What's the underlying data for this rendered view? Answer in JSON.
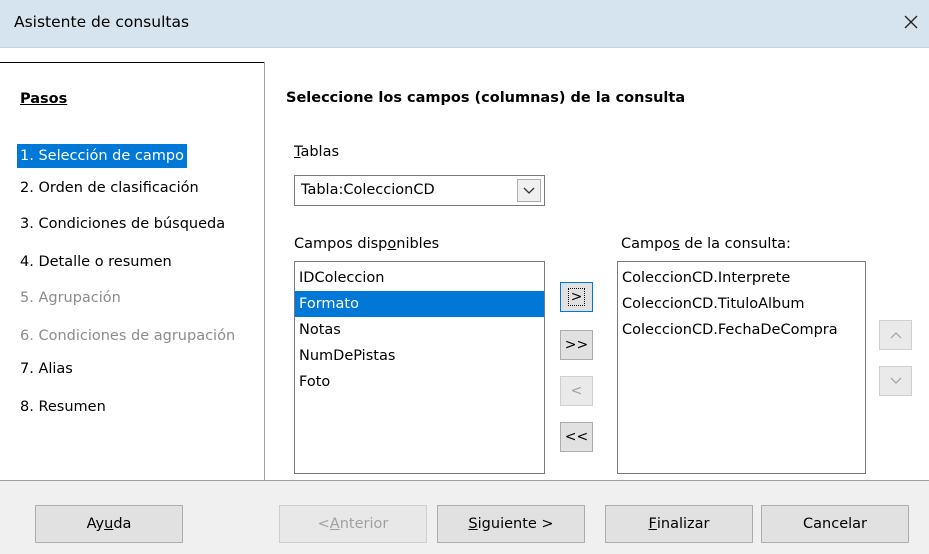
{
  "window": {
    "title": "Asistente de consultas",
    "close_glyph": "✕"
  },
  "steps": {
    "title": "Pasos",
    "items": [
      {
        "label": "1. Selección de campo",
        "state": "selected"
      },
      {
        "label": "2. Orden de clasificación",
        "state": "normal"
      },
      {
        "label": "3. Condiciones de búsqueda",
        "state": "normal"
      },
      {
        "label": "4. Detalle o resumen",
        "state": "normal"
      },
      {
        "label": "5. Agrupación",
        "state": "disabled"
      },
      {
        "label": "6. Condiciones de agrupación",
        "state": "disabled"
      },
      {
        "label": "7. Alias",
        "state": "normal"
      },
      {
        "label": "8. Resumen",
        "state": "normal"
      }
    ]
  },
  "main": {
    "heading": "Seleccione los campos (columnas) de la consulta",
    "tables_label_mnemonic": "T",
    "tables_label_rest": "ablas",
    "tables_value": "Tabla:ColeccionCD",
    "available_label_pre": "Campos disp",
    "available_label_mnemonic": "o",
    "available_label_post": "nibles",
    "available_fields": [
      "IDColeccion",
      "Formato",
      "Notas",
      "NumDePistas",
      "Foto"
    ],
    "available_selected": "Formato",
    "query_label_pre": "Campo",
    "query_label_mnemonic": "s",
    "query_label_post": " de la consulta:",
    "query_fields": [
      "ColeccionCD.Interprete",
      "ColeccionCD.TituloAlbum",
      "ColeccionCD.FechaDeCompra"
    ],
    "move_buttons": {
      "add_one": ">",
      "add_all": ">>",
      "remove_one": "<",
      "remove_all": "<<"
    },
    "order_buttons": {
      "up": "^",
      "down": "v"
    }
  },
  "footer": {
    "help_pre": "Ay",
    "help_mnemonic": "u",
    "help_post": "da",
    "back_pre": "< ",
    "back_mnemonic": "A",
    "back_post": "nterior",
    "next_mnemonic": "S",
    "next_post": "iguiente >",
    "finish_mnemonic": "F",
    "finish_post": "inalizar",
    "cancel": "Cancelar"
  },
  "colors": {
    "titlebar": "#d6e4ef",
    "selection": "#0078d7"
  }
}
